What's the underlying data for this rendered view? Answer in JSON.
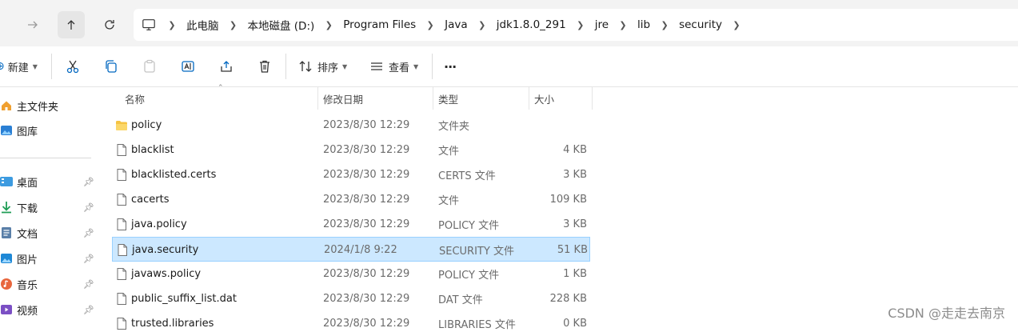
{
  "address_bar": {
    "crumbs": [
      "此电脑",
      "本地磁盘 (D:)",
      "Program Files",
      "Java",
      "jdk1.8.0_291",
      "jre",
      "lib",
      "security"
    ]
  },
  "toolbar": {
    "new_label": "新建",
    "sort_label": "排序",
    "view_label": "查看",
    "more_label": "···"
  },
  "sidebar": {
    "items": [
      {
        "label": "主文件夹",
        "icon": "home-icon"
      },
      {
        "label": "图库",
        "icon": "gallery-icon"
      },
      {
        "label": "桌面",
        "icon": "desktop-icon",
        "pinned": true
      },
      {
        "label": "下载",
        "icon": "download-icon",
        "pinned": true
      },
      {
        "label": "文档",
        "icon": "documents-icon",
        "pinned": true
      },
      {
        "label": "图片",
        "icon": "pictures-icon",
        "pinned": true
      },
      {
        "label": "音乐",
        "icon": "music-icon",
        "pinned": true
      },
      {
        "label": "视频",
        "icon": "videos-icon",
        "pinned": true
      }
    ]
  },
  "columns": {
    "name": "名称",
    "modified": "修改日期",
    "type": "类型",
    "size": "大小"
  },
  "files": [
    {
      "name": "policy",
      "modified": "2023/8/30 12:29",
      "type": "文件夹",
      "size": "",
      "kind": "folder"
    },
    {
      "name": "blacklist",
      "modified": "2023/8/30 12:29",
      "type": "文件",
      "size": "4 KB",
      "kind": "file"
    },
    {
      "name": "blacklisted.certs",
      "modified": "2023/8/30 12:29",
      "type": "CERTS 文件",
      "size": "3 KB",
      "kind": "file"
    },
    {
      "name": "cacerts",
      "modified": "2023/8/30 12:29",
      "type": "文件",
      "size": "109 KB",
      "kind": "file"
    },
    {
      "name": "java.policy",
      "modified": "2023/8/30 12:29",
      "type": "POLICY 文件",
      "size": "3 KB",
      "kind": "file"
    },
    {
      "name": "java.security",
      "modified": "2024/1/8 9:22",
      "type": "SECURITY 文件",
      "size": "51 KB",
      "kind": "file",
      "selected": true
    },
    {
      "name": "javaws.policy",
      "modified": "2023/8/30 12:29",
      "type": "POLICY 文件",
      "size": "1 KB",
      "kind": "file"
    },
    {
      "name": "public_suffix_list.dat",
      "modified": "2023/8/30 12:29",
      "type": "DAT 文件",
      "size": "228 KB",
      "kind": "file"
    },
    {
      "name": "trusted.libraries",
      "modified": "2023/8/30 12:29",
      "type": "LIBRARIES 文件",
      "size": "0 KB",
      "kind": "file"
    }
  ],
  "watermark": "CSDN @走走去南京",
  "colors": {
    "selection_bg": "#cce8ff",
    "selection_border": "#99d1ff",
    "folder": "#f5c343",
    "accent": "#0067c0"
  }
}
